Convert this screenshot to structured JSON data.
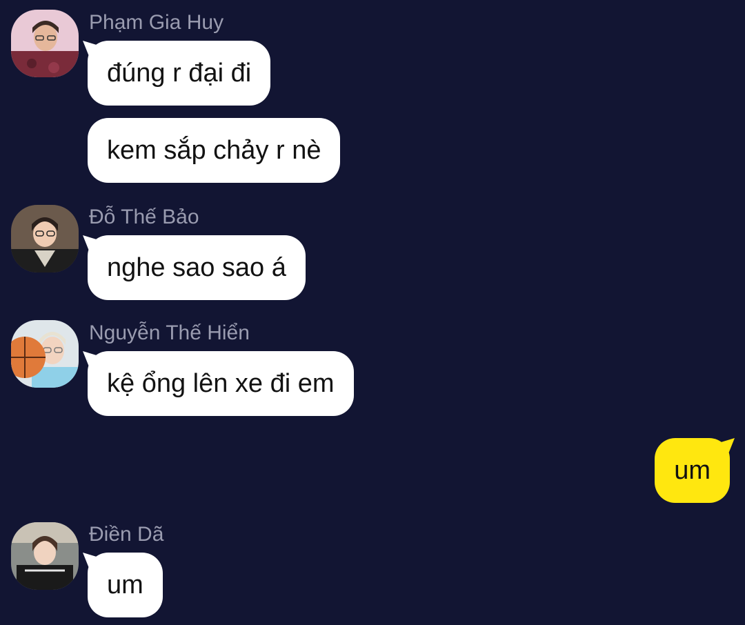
{
  "messages": [
    {
      "sender": "Phạm Gia Huy",
      "bubbles": [
        "đúng r đại đi",
        "kem sắp chảy r nè"
      ]
    },
    {
      "sender": "Đỗ Thế Bảo",
      "bubbles": [
        "nghe sao sao á"
      ]
    },
    {
      "sender": "Nguyễn Thế Hiển",
      "bubbles": [
        "kệ ổng lên xe đi em"
      ]
    },
    {
      "self": true,
      "bubbles": [
        "um"
      ]
    },
    {
      "sender": "Điền Dã",
      "bubbles": [
        "um"
      ]
    }
  ],
  "colors": {
    "background": "#121533",
    "incoming_bubble": "#ffffff",
    "outgoing_bubble": "#ffe70f",
    "sender_name": "#9a9cb0"
  }
}
